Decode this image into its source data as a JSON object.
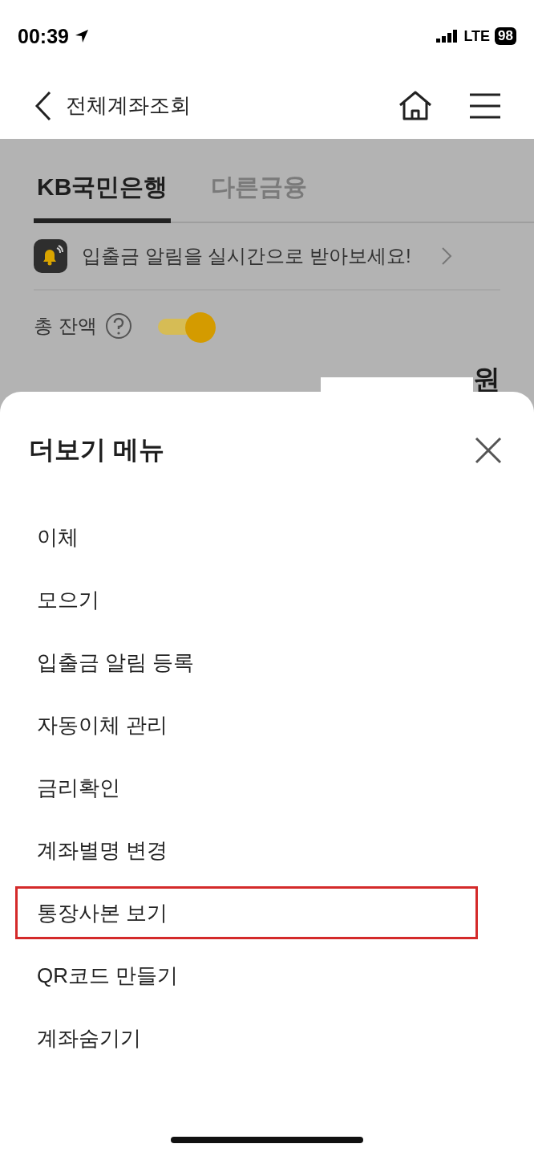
{
  "status_bar": {
    "time": "00:39",
    "network": "LTE",
    "battery": "98"
  },
  "header": {
    "title": "전체계좌조회"
  },
  "tabs": [
    {
      "label": "KB국민은행",
      "selected": true
    },
    {
      "label": "다른금융",
      "selected": false
    }
  ],
  "notice": {
    "text": "입출금 알림을 실시간으로 받아보세요!"
  },
  "balance": {
    "label": "총 잔액",
    "toggle_on": true,
    "currency": "원"
  },
  "sheet": {
    "title": "더보기 메뉴",
    "items": [
      {
        "label": "이체",
        "highlighted": false
      },
      {
        "label": "모으기",
        "highlighted": false
      },
      {
        "label": "입출금 알림 등록",
        "highlighted": false
      },
      {
        "label": "자동이체 관리",
        "highlighted": false
      },
      {
        "label": "금리확인",
        "highlighted": false
      },
      {
        "label": "계좌별명 변경",
        "highlighted": false
      },
      {
        "label": "통장사본 보기",
        "highlighted": true
      },
      {
        "label": "QR코드 만들기",
        "highlighted": false
      },
      {
        "label": "계좌숨기기",
        "highlighted": false
      }
    ]
  }
}
